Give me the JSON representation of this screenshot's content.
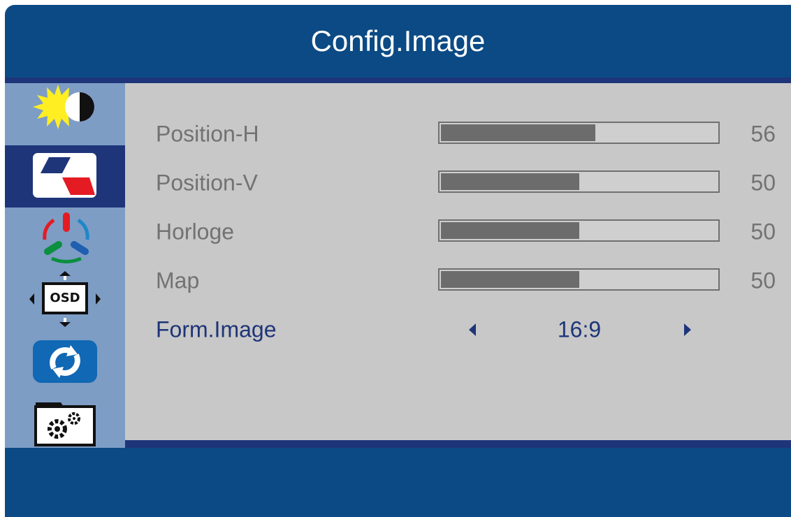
{
  "title": "Config.Image",
  "sidebar": {
    "items": [
      {
        "name": "brightness-contrast-icon",
        "active": false
      },
      {
        "name": "image-setup-icon",
        "active": true
      },
      {
        "name": "color-temperature-icon",
        "active": false
      },
      {
        "name": "osd-settings-icon",
        "active": false
      },
      {
        "name": "reset-icon",
        "active": false
      },
      {
        "name": "misc-settings-icon",
        "active": false
      }
    ],
    "osd_icon_label": "OSD"
  },
  "settings": {
    "position_h": {
      "label": "Position-H",
      "value": "56",
      "level": 56
    },
    "position_v": {
      "label": "Position-V",
      "value": "50",
      "level": 50
    },
    "clock": {
      "label": "Horloge",
      "value": "50",
      "level": 50
    },
    "phase": {
      "label": "Map",
      "value": "50",
      "level": 50
    },
    "aspect": {
      "label": "Form.Image",
      "value": "16:9"
    }
  },
  "colors": {
    "osd_background": "#0b4a84",
    "highlight": "#1e3579",
    "sidebar": "#7d9dc5",
    "content": "#c8c8c8",
    "bar_fill": "#6c6c6c",
    "text_inactive": "#727272"
  }
}
